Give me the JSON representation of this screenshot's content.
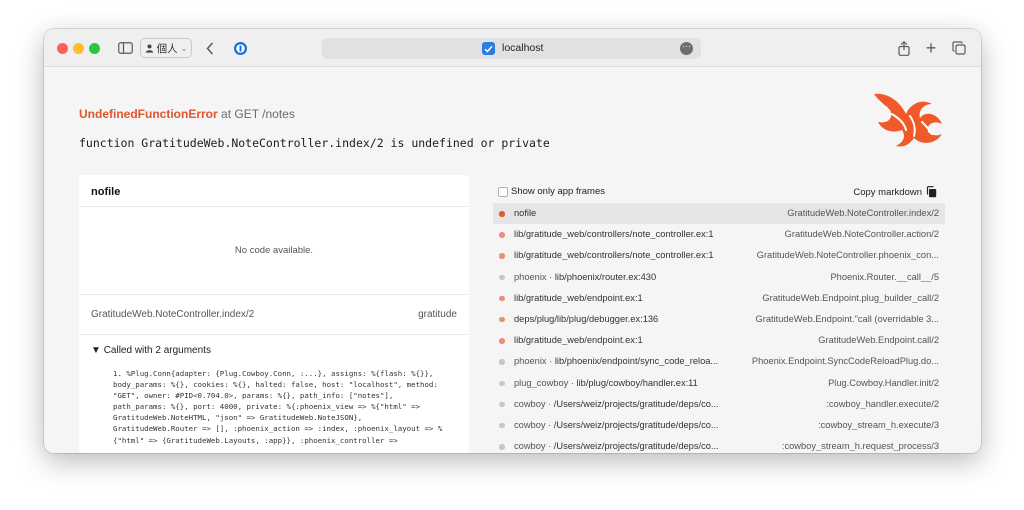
{
  "browser": {
    "profile_label": "個人",
    "address": "localhost"
  },
  "colors": {
    "accent": "#e0552e",
    "frame_app_dot": "#e88f75",
    "frame_lib_dot": "#c7c7c7",
    "frame_selected_dot": "#e5573a"
  },
  "error": {
    "type": "UndefinedFunctionError",
    "location": "at GET /notes",
    "message": "function GratitudeWeb.NoteController.index/2 is undefined or private"
  },
  "code_panel": {
    "file": "nofile",
    "no_code": "No code available.",
    "module_function": "GratitudeWeb.NoteController.index/2",
    "app": "gratitude",
    "args_title": "Called with 2 arguments",
    "args_code": "1. %Plug.Conn{adapter: {Plug.Cowboy.Conn, :...}, assigns: %{flash: %{}},\nbody_params: %{}, cookies: %{}, halted: false, host: \"localhost\", method:\n\"GET\", owner: #PID<0.704.0>, params: %{}, path_info: [\"notes\"],\npath_params: %{}, port: 4000, private: %{:phoenix_view => %{\"html\" =>\nGratitudeWeb.NoteHTML, \"json\" => GratitudeWeb.NoteJSON},\nGratitudeWeb.Router => [], :phoenix_action => :index, :phoenix_layout => %\n{\"html\" => {GratitudeWeb.Layouts, :app}}, :phoenix_controller =>"
  },
  "frames_panel": {
    "show_only_app_label": "Show only app frames",
    "copy_label": "Copy markdown",
    "frames": [
      {
        "app": "",
        "file": "nofile",
        "func": "GratitudeWeb.NoteController.index/2",
        "kind": "selected"
      },
      {
        "app": "",
        "file": "lib/gratitude_web/controllers/note_controller.ex:1",
        "func": "GratitudeWeb.NoteController.action/2",
        "kind": "app"
      },
      {
        "app": "",
        "file": "lib/gratitude_web/controllers/note_controller.ex:1",
        "func": "GratitudeWeb.NoteController.phoenix_con...",
        "kind": "app"
      },
      {
        "app": "phoenix · ",
        "file": "lib/phoenix/router.ex:430",
        "func": "Phoenix.Router.__call__/5",
        "kind": "lib"
      },
      {
        "app": "",
        "file": "lib/gratitude_web/endpoint.ex:1",
        "func": "GratitudeWeb.Endpoint.plug_builder_call/2",
        "kind": "app"
      },
      {
        "app": "",
        "file": "deps/plug/lib/plug/debugger.ex:136",
        "func": "GratitudeWeb.Endpoint.\"call (overridable 3...",
        "kind": "app"
      },
      {
        "app": "",
        "file": "lib/gratitude_web/endpoint.ex:1",
        "func": "GratitudeWeb.Endpoint.call/2",
        "kind": "app"
      },
      {
        "app": "phoenix · ",
        "file": "lib/phoenix/endpoint/sync_code_reloa...",
        "func": "Phoenix.Endpoint.SyncCodeReloadPlug.do...",
        "kind": "lib"
      },
      {
        "app": "plug_cowboy · ",
        "file": "lib/plug/cowboy/handler.ex:11",
        "func": "Plug.Cowboy.Handler.init/2",
        "kind": "lib"
      },
      {
        "app": "cowboy · ",
        "file": "/Users/weiz/projects/gratitude/deps/co...",
        "func": ":cowboy_handler.execute/2",
        "kind": "lib"
      },
      {
        "app": "cowboy · ",
        "file": "/Users/weiz/projects/gratitude/deps/co...",
        "func": ":cowboy_stream_h.execute/3",
        "kind": "lib"
      },
      {
        "app": "cowboy · ",
        "file": "/Users/weiz/projects/gratitude/deps/co...",
        "func": ":cowboy_stream_h.request_process/3",
        "kind": "lib"
      }
    ]
  }
}
